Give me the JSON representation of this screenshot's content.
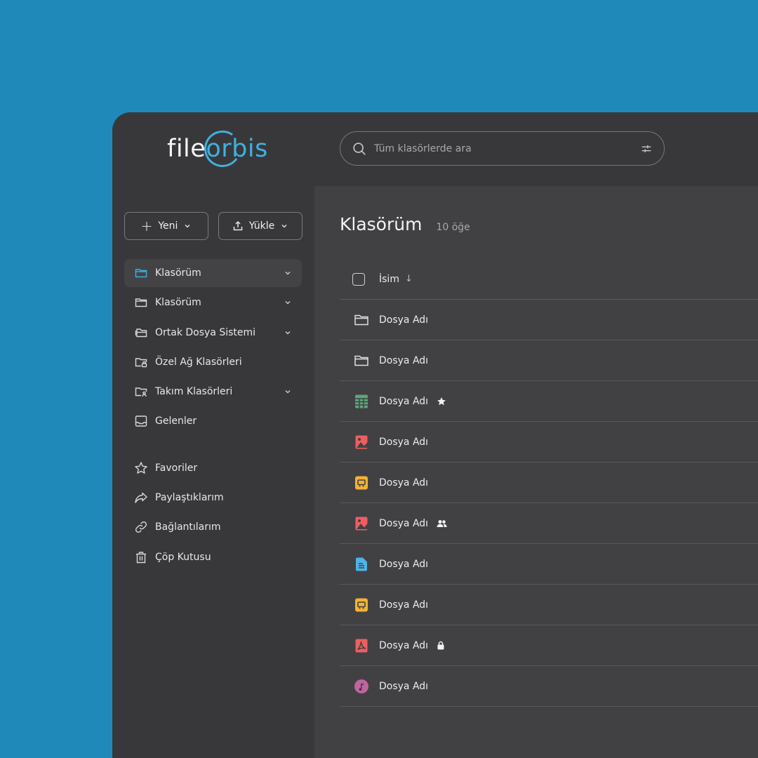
{
  "app": {
    "logo_prefix": "file",
    "logo_orb": "orb",
    "logo_suffix": "is"
  },
  "search": {
    "placeholder": "Tüm klasörlerde ara",
    "icon": "search-icon",
    "filter_icon": "filter-sliders-icon"
  },
  "toolbar": {
    "new_label": "Yeni",
    "upload_label": "Yükle"
  },
  "sidebar": {
    "items": [
      {
        "label": "Klasörüm",
        "icon": "folder-icon",
        "active": true,
        "expandable": true
      },
      {
        "label": "Klasörüm",
        "icon": "folder-icon",
        "active": false,
        "expandable": true
      },
      {
        "label": "Ortak Dosya Sistemi",
        "icon": "shared-folders-icon",
        "active": false,
        "expandable": true
      },
      {
        "label": "Özel Ağ Klasörleri",
        "icon": "locked-folder-icon",
        "active": false,
        "expandable": false
      },
      {
        "label": "Takım Klasörleri",
        "icon": "team-folder-icon",
        "active": false,
        "expandable": true
      },
      {
        "label": "Gelenler",
        "icon": "inbox-icon",
        "active": false,
        "expandable": false
      }
    ],
    "secondary": [
      {
        "label": "Favoriler",
        "icon": "star-icon"
      },
      {
        "label": "Paylaştıklarım",
        "icon": "share-icon"
      },
      {
        "label": "Bağlantılarım",
        "icon": "link-icon"
      },
      {
        "label": "Çöp Kutusu",
        "icon": "trash-icon"
      }
    ]
  },
  "main": {
    "title": "Klasörüm",
    "count": "10 öğe",
    "column_name": "İsim",
    "sort_indicator": "↓",
    "rows": [
      {
        "name": "Dosya Adı",
        "type": "folder",
        "badge": ""
      },
      {
        "name": "Dosya Adı",
        "type": "folder",
        "badge": ""
      },
      {
        "name": "Dosya Adı",
        "type": "spreadsheet",
        "badge": "star"
      },
      {
        "name": "Dosya Adı",
        "type": "image",
        "badge": ""
      },
      {
        "name": "Dosya Adı",
        "type": "presentation",
        "badge": ""
      },
      {
        "name": "Dosya Adı",
        "type": "image",
        "badge": "shared"
      },
      {
        "name": "Dosya Adı",
        "type": "document",
        "badge": ""
      },
      {
        "name": "Dosya Adı",
        "type": "presentation",
        "badge": ""
      },
      {
        "name": "Dosya Adı",
        "type": "pdf",
        "badge": "lock"
      },
      {
        "name": "Dosya Adı",
        "type": "audio",
        "badge": ""
      }
    ]
  },
  "colors": {
    "background": "#1f8aba",
    "panel": "#38383b",
    "content": "#414144",
    "accent": "#3fb0e0",
    "spreadsheet": "#5fa67b",
    "image": "#ee5e60",
    "presentation": "#f2b233",
    "document": "#4fb3e6",
    "pdf": "#ee5e60",
    "audio": "#c0649f"
  }
}
